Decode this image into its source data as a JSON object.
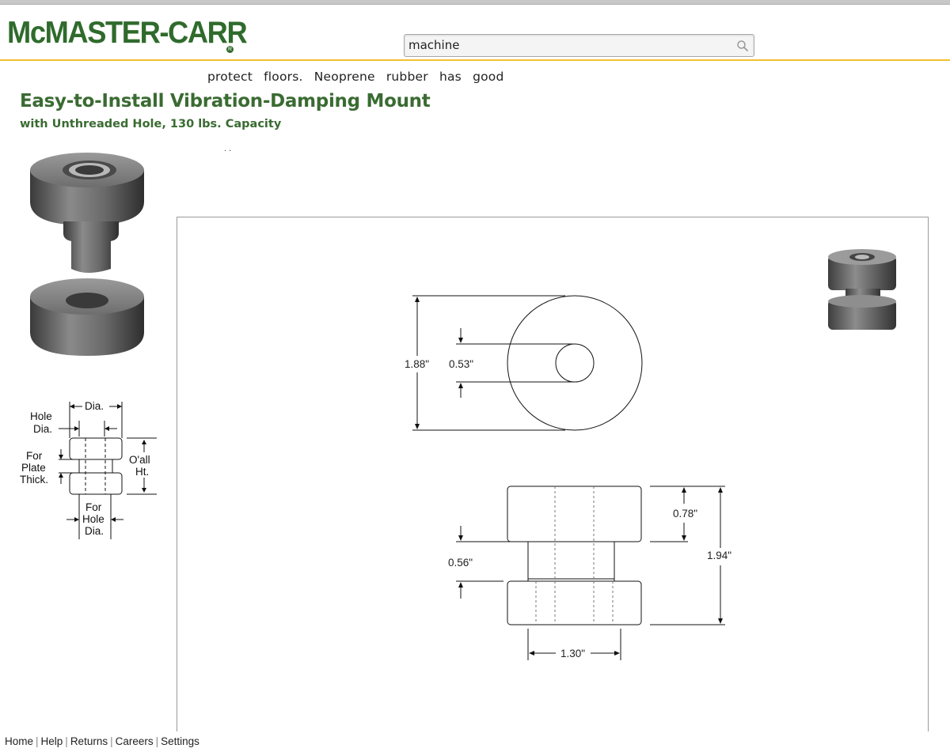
{
  "header": {
    "logo_main": "McMASTER-CARR",
    "logo_mark": "R"
  },
  "search": {
    "value": "machine"
  },
  "description_fragment": "protect floors. Neoprene rubber has good",
  "description_dots": "..",
  "product": {
    "title": "Easy-to-Install Vibration-Damping Mount",
    "subtitle": "with Unthreaded Hole, 130 lbs. Capacity"
  },
  "dimension_diagram": {
    "dia": "Dia.",
    "hole": "Hole",
    "hole_dia": "Dia.",
    "for": "For",
    "plate": "Plate",
    "thick": "Thick.",
    "oall": "O'all",
    "ht": "Ht.",
    "for2": "For",
    "hole2": "Hole",
    "dia2": "Dia."
  },
  "drawing": {
    "dim_od": "1.88\"",
    "dim_hole": "0.53\"",
    "dim_top_height": "0.78\"",
    "dim_overall_height": "1.94\"",
    "dim_plate": "0.56\"",
    "dim_stem_dia": "1.30\""
  },
  "footer": {
    "links": [
      "Home",
      "Help",
      "Returns",
      "Careers",
      "Settings"
    ]
  }
}
